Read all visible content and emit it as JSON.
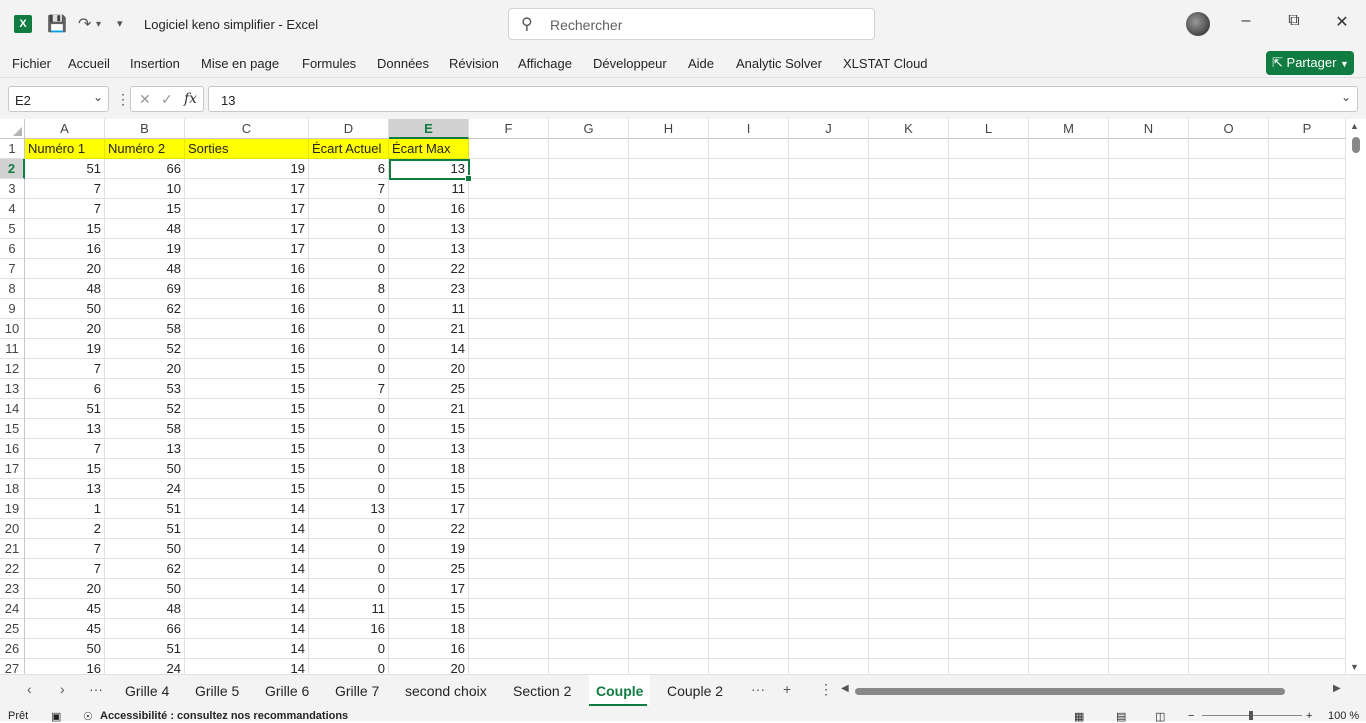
{
  "app": {
    "window_title": "Logiciel keno simplifier  -  Excel",
    "search_placeholder": "Rechercher",
    "share_label": "Partager"
  },
  "menu": [
    "Fichier",
    "Accueil",
    "Insertion",
    "Mise en page",
    "Formules",
    "Données",
    "Révision",
    "Affichage",
    "Développeur",
    "Aide",
    "Analytic Solver",
    "XLSTAT Cloud"
  ],
  "formula_bar": {
    "name_box": "E2",
    "fx_label": "fx",
    "content": "13"
  },
  "columns": [
    "A",
    "B",
    "C",
    "D",
    "E",
    "F",
    "G",
    "H",
    "I",
    "J",
    "K",
    "L",
    "M",
    "N",
    "O",
    "P"
  ],
  "selected_cell": {
    "column": "E",
    "row": 2
  },
  "headers": [
    "Numéro 1",
    "Numéro 2",
    "Sorties",
    "Écart Actuel",
    "Écart Max"
  ],
  "rows": [
    {
      "n": 2,
      "v": [
        51,
        66,
        19,
        6,
        13
      ]
    },
    {
      "n": 3,
      "v": [
        7,
        10,
        17,
        7,
        11
      ]
    },
    {
      "n": 4,
      "v": [
        7,
        15,
        17,
        0,
        16
      ]
    },
    {
      "n": 5,
      "v": [
        15,
        48,
        17,
        0,
        13
      ]
    },
    {
      "n": 6,
      "v": [
        16,
        19,
        17,
        0,
        13
      ]
    },
    {
      "n": 7,
      "v": [
        20,
        48,
        16,
        0,
        22
      ]
    },
    {
      "n": 8,
      "v": [
        48,
        69,
        16,
        8,
        23
      ]
    },
    {
      "n": 9,
      "v": [
        50,
        62,
        16,
        0,
        11
      ]
    },
    {
      "n": 10,
      "v": [
        20,
        58,
        16,
        0,
        21
      ]
    },
    {
      "n": 11,
      "v": [
        19,
        52,
        16,
        0,
        14
      ]
    },
    {
      "n": 12,
      "v": [
        7,
        20,
        15,
        0,
        20
      ]
    },
    {
      "n": 13,
      "v": [
        6,
        53,
        15,
        7,
        25
      ]
    },
    {
      "n": 14,
      "v": [
        51,
        52,
        15,
        0,
        21
      ]
    },
    {
      "n": 15,
      "v": [
        13,
        58,
        15,
        0,
        15
      ]
    },
    {
      "n": 16,
      "v": [
        7,
        13,
        15,
        0,
        13
      ]
    },
    {
      "n": 17,
      "v": [
        15,
        50,
        15,
        0,
        18
      ]
    },
    {
      "n": 18,
      "v": [
        13,
        24,
        15,
        0,
        15
      ]
    },
    {
      "n": 19,
      "v": [
        1,
        51,
        14,
        13,
        17
      ]
    },
    {
      "n": 20,
      "v": [
        2,
        51,
        14,
        0,
        22
      ]
    },
    {
      "n": 21,
      "v": [
        7,
        50,
        14,
        0,
        19
      ]
    },
    {
      "n": 22,
      "v": [
        7,
        62,
        14,
        0,
        25
      ]
    },
    {
      "n": 23,
      "v": [
        20,
        50,
        14,
        0,
        17
      ]
    },
    {
      "n": 24,
      "v": [
        45,
        48,
        14,
        11,
        15
      ]
    },
    {
      "n": 25,
      "v": [
        45,
        66,
        14,
        16,
        18
      ]
    },
    {
      "n": 26,
      "v": [
        50,
        51,
        14,
        0,
        16
      ]
    },
    {
      "n": 27,
      "v": [
        16,
        24,
        14,
        0,
        20
      ]
    }
  ],
  "sheet_tabs": [
    "Grille 4",
    "Grille 5",
    "Grille 6",
    "Grille 7",
    "second choix",
    "Section 2",
    "Couple",
    "Couple 2"
  ],
  "active_tab": "Couple",
  "status": {
    "ready": "Prêt",
    "accessibility": "Accessibilité : consultez nos recommandations",
    "zoom": "100 %"
  },
  "colors": {
    "accent": "#107c41",
    "header_fill": "#ffff00"
  }
}
